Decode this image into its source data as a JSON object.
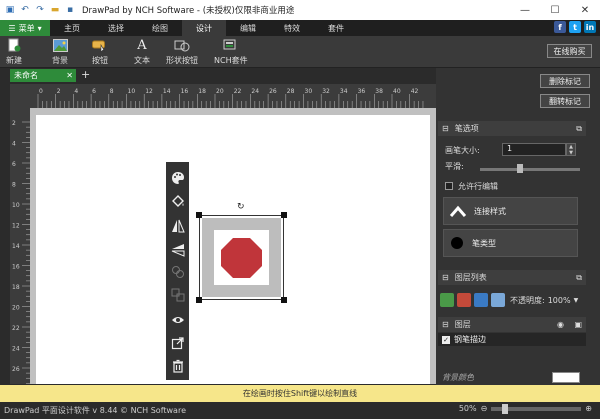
{
  "window": {
    "title": "DrawPad by NCH Software - (未授权)仅限非商业用途",
    "minimize": "—",
    "maximize": "☐",
    "close": "✕"
  },
  "menu_button": {
    "label": "菜单",
    "arrow": "▾"
  },
  "tabs": [
    {
      "label": "主页"
    },
    {
      "label": "选择"
    },
    {
      "label": "绘图"
    },
    {
      "label": "设计"
    },
    {
      "label": "编辑"
    },
    {
      "label": "特效"
    },
    {
      "label": "套件"
    }
  ],
  "social": [
    {
      "label": "f",
      "color": "#3b5998"
    },
    {
      "label": "t",
      "color": "#1da1f2"
    },
    {
      "label": "in",
      "color": "#0077b5"
    }
  ],
  "ribbon": {
    "new_label": "新建",
    "background_label": "背景",
    "button_label": "按钮",
    "text_label": "文本",
    "shape_button_label": "形状按钮",
    "nch_suite_label": "NCH套件",
    "share_label": "在线购买"
  },
  "doc": {
    "tab_name": "未命名",
    "close": "✕",
    "add": "+"
  },
  "ruler": {
    "h_labels": [
      "0",
      "2",
      "4",
      "6",
      "8",
      "10",
      "12",
      "14",
      "16",
      "18",
      "20",
      "22",
      "24",
      "26",
      "28",
      "30",
      "32",
      "34",
      "36",
      "38",
      "40",
      "42"
    ],
    "v_labels": [
      "2",
      "4",
      "6",
      "8",
      "10",
      "12",
      "14",
      "16",
      "18",
      "20",
      "22",
      "24",
      "26"
    ]
  },
  "right_panel": {
    "delete_mark": "删除标记",
    "flip_mark": "翻转标记",
    "pen_section": "笔选项",
    "brush_size_label": "画笔大小:",
    "brush_size_value": "1",
    "smooth_label": "平滑:",
    "smooth_level": 0.4,
    "allow_edit_label": "允许行编辑",
    "connect_style_label": "连接样式",
    "pen_type_label": "笔类型",
    "layers_list": "图层列表",
    "opacity_label": "不透明度:",
    "opacity_value": "100%",
    "layers_section": "图层",
    "layer_name": "钢笔描边",
    "background_color_label": "背景颜色"
  },
  "status": {
    "hint": "在绘画时按住Shift键以绘制直线",
    "version": "DrawPad 平面设计软件 v 8.44 © NCH Software",
    "zoom": "50%",
    "zoom_level": 0.15
  },
  "colors": {
    "accent_green": "#2e8b3a",
    "stop_red": "#c0353a",
    "status_yellow": "#f6e68a"
  }
}
